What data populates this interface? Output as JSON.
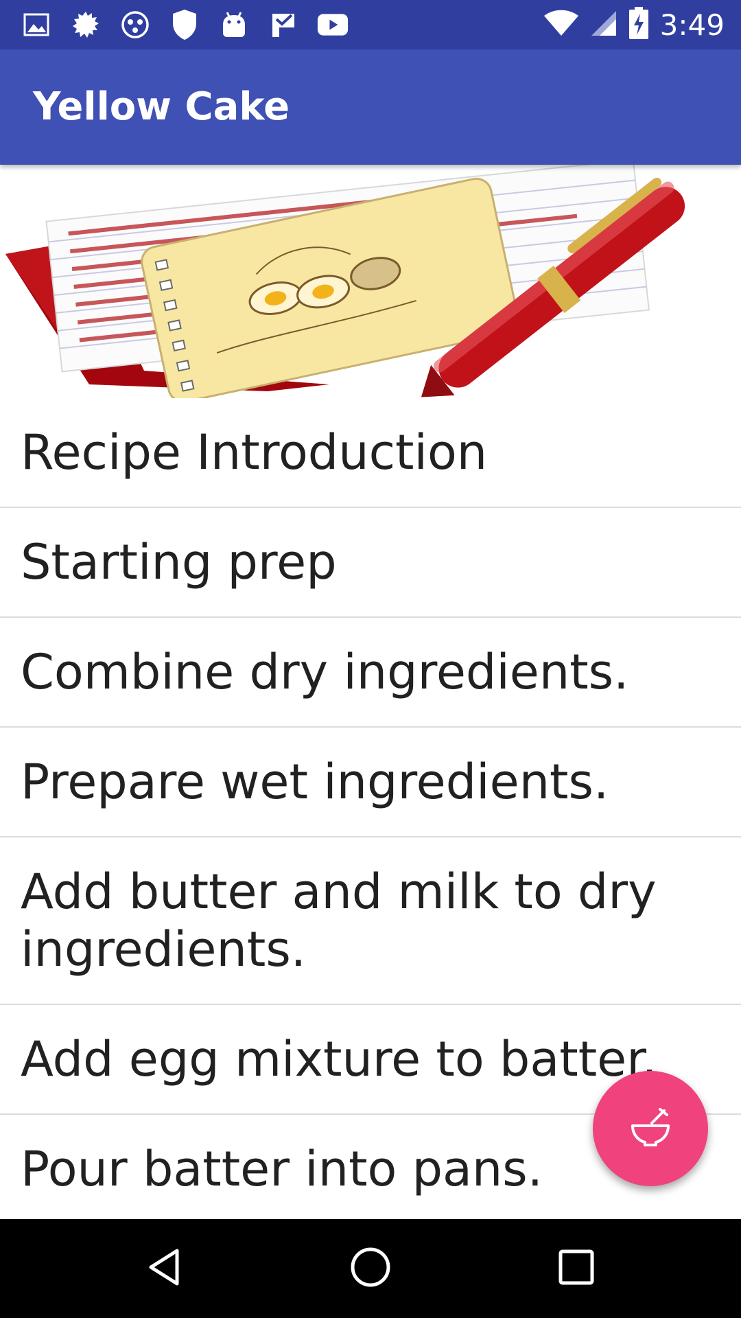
{
  "status_bar": {
    "time": "3:49",
    "left_icons": [
      "image-icon",
      "settings-burst-icon",
      "circle-dots-icon",
      "shield-icon",
      "android-icon",
      "check-flag-icon",
      "youtube-icon"
    ],
    "right_icons": [
      "wifi-icon",
      "cell-signal-icon",
      "battery-charging-icon"
    ]
  },
  "app_bar": {
    "title": "Yellow Cake",
    "color": "#3f51b5"
  },
  "steps": [
    "Recipe Introduction",
    "Starting prep",
    "Combine dry ingredients.",
    "Prepare wet ingredients.",
    "Add butter and milk to dry ingredients.",
    "Add egg mixture to batter.",
    "Pour batter into pans."
  ],
  "fab": {
    "icon": "mortar-pestle-icon",
    "color": "#f0427d"
  },
  "nav_bar": {
    "icons": [
      "back-icon",
      "home-icon",
      "recents-icon"
    ]
  }
}
